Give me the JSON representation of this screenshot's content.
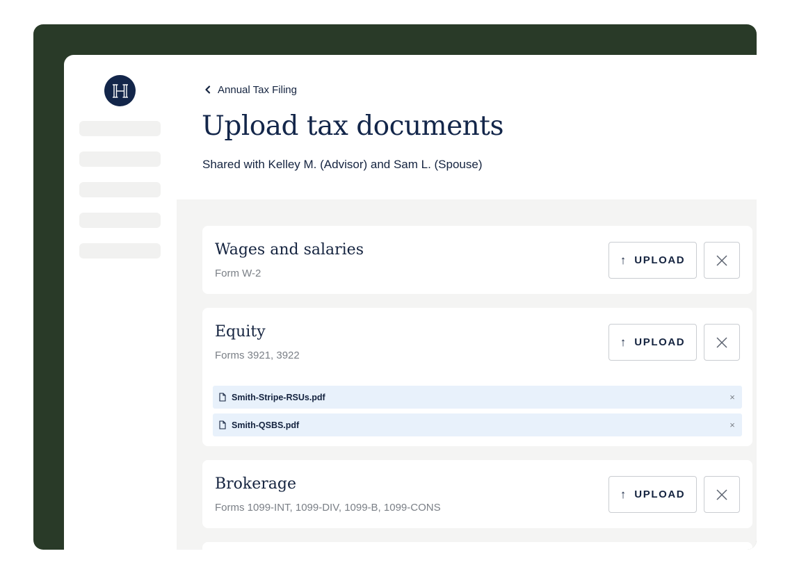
{
  "header": {
    "breadcrumb": "Annual Tax Filing",
    "title": "Upload tax documents",
    "subtitle": "Shared with Kelley M. (Advisor) and Sam L. (Spouse)"
  },
  "colors": {
    "frame": "#293a28",
    "brand_navy": "#13264a",
    "file_row_bg": "#e8f1fb",
    "panel_bg": "#f4f4f3"
  },
  "icons": {
    "logo": "h-monogram-icon",
    "breadcrumb": "chevron-left-icon",
    "upload": "arrow-up-icon",
    "close": "close-icon",
    "file": "document-icon"
  },
  "cards": [
    {
      "title": "Wages and salaries",
      "subtitle": "Form W-2",
      "upload_label": "UPLOAD",
      "files": []
    },
    {
      "title": "Equity",
      "subtitle": "Forms 3921, 3922",
      "upload_label": "UPLOAD",
      "files": [
        {
          "name": "Smith-Stripe-RSUs.pdf",
          "remove": "×"
        },
        {
          "name": "Smith-QSBS.pdf",
          "remove": "×"
        }
      ]
    },
    {
      "title": "Brokerage",
      "subtitle": "Forms 1099-INT, 1099-DIV, 1099-B, 1099-CONS",
      "upload_label": "UPLOAD",
      "files": []
    }
  ]
}
